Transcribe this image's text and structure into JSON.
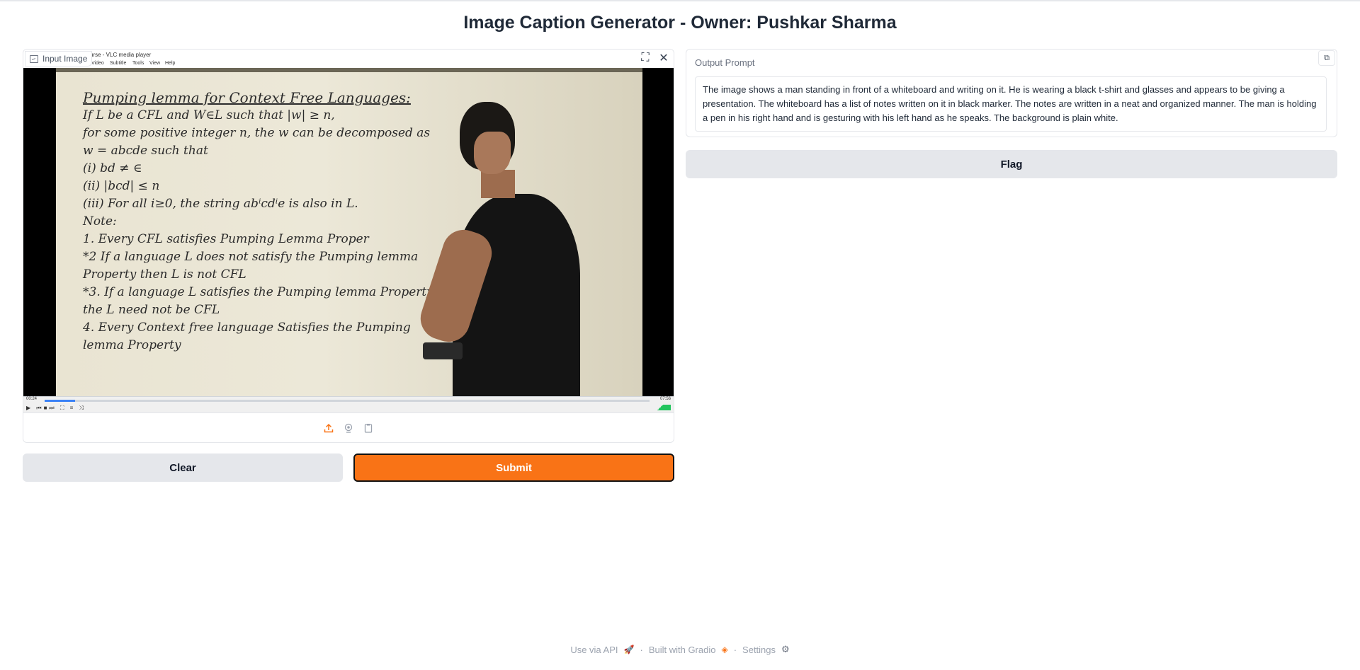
{
  "page": {
    "title": "Image Caption Generator - Owner: Pushkar Sharma"
  },
  "input_panel": {
    "label": "Input Image",
    "icons": [
      "image-icon",
      "fullscreen-icon",
      "close-icon",
      "upload-icon",
      "webcam-icon",
      "clipboard-icon"
    ],
    "vlc": {
      "title": "urse - VLC media player",
      "menu": [
        "Video",
        "Subtitle",
        "Tools",
        "View",
        "Help"
      ],
      "time_elapsed": "00:24",
      "time_total": "07:56",
      "progress": 0.05,
      "board_lines": [
        "Pumping lemma for Context Free Languages:",
        "If L be a CFL and W∈L such that |w| ≥ n,",
        "for some positive integer n, the w can be decomposed as",
        "w = abcde such that",
        "(i)  bd ≠ ∈",
        "(ii)  |bcd| ≤ n",
        "(iii)  For all i≥0, the string abⁱcdⁱe is also in L.",
        "Note:",
        "1. Every CFL satisfies Pumping Lemma Proper",
        "*2  If a language L does not satisfy the Pumping lemma",
        "     Property then L is not CFL",
        "*3. If a language L satisfies the Pumping lemma Property",
        "     the L need not be CFL",
        "4. Every Context free language Satisfies the Pumping",
        "     lemma Property"
      ]
    }
  },
  "buttons": {
    "clear": "Clear",
    "submit": "Submit",
    "flag": "Flag"
  },
  "output": {
    "label": "Output Prompt",
    "text": "The image shows a man standing in front of a whiteboard and writing on it. He is wearing a black t-shirt and glasses and appears to be giving a presentation. The whiteboard has a list of notes written on it in black marker. The notes are written in a neat and organized manner. The man is holding a pen in his right hand and is gesturing with his left hand as he speaks. The background is plain white."
  },
  "footer": {
    "api": "Use via API",
    "built": "Built with Gradio",
    "settings": "Settings"
  },
  "colors": {
    "accent": "#f97316",
    "button_gray": "#e5e7eb"
  }
}
